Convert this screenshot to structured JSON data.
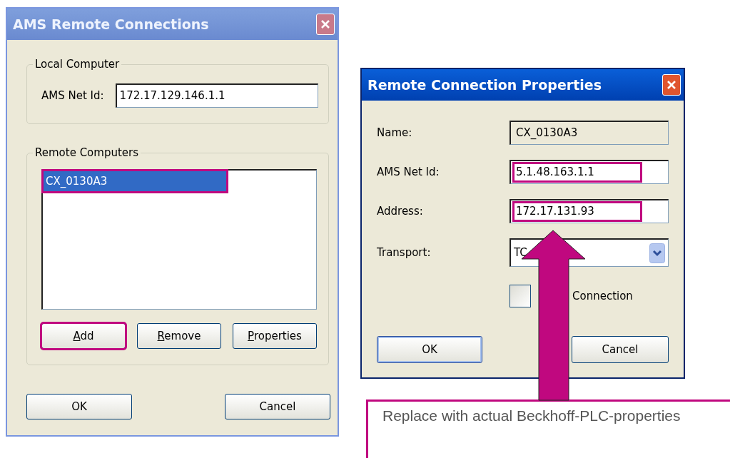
{
  "connections_dialog": {
    "title": "AMS Remote Connections",
    "active": false,
    "local_group": {
      "label": "Local Computer",
      "net_id_label": "AMS Net Id:",
      "net_id_value": "172.17.129.146.1.1"
    },
    "remote_group": {
      "label": "Remote Computers",
      "items": [
        {
          "text": "CX_0130A3",
          "selected": true,
          "annotated": true
        }
      ],
      "buttons": [
        {
          "label": "Add",
          "underline_first": true,
          "annotated": true
        },
        {
          "label": "Remove",
          "underline_first": true,
          "annotated": false
        },
        {
          "label": "Properties",
          "underline_first": true,
          "annotated": false
        }
      ]
    },
    "buttons": [
      {
        "label": "OK",
        "default": false
      },
      {
        "label": "Cancel",
        "default": false
      }
    ]
  },
  "properties_dialog": {
    "title": "Remote Connection Properties",
    "active": true,
    "fields": [
      {
        "kind": "text",
        "label": "Name:",
        "value": "CX_0130A3",
        "annotated": false
      },
      {
        "kind": "text",
        "label": "AMS Net Id:",
        "value": "5.1.48.163.1.1",
        "annotated": true
      },
      {
        "kind": "text",
        "label": "Address:",
        "value": "172.17.131.93",
        "annotated": true
      },
      {
        "kind": "combo",
        "label": "Transport:",
        "value": "TC",
        "annotated": false
      }
    ],
    "checkbox": {
      "label": "Connection",
      "checked": false
    },
    "buttons": [
      {
        "label": "OK",
        "default": true
      },
      {
        "label": "Cancel",
        "default": false
      }
    ]
  },
  "callout": {
    "text": "Replace with actual Beckhoff-PLC-properties"
  }
}
